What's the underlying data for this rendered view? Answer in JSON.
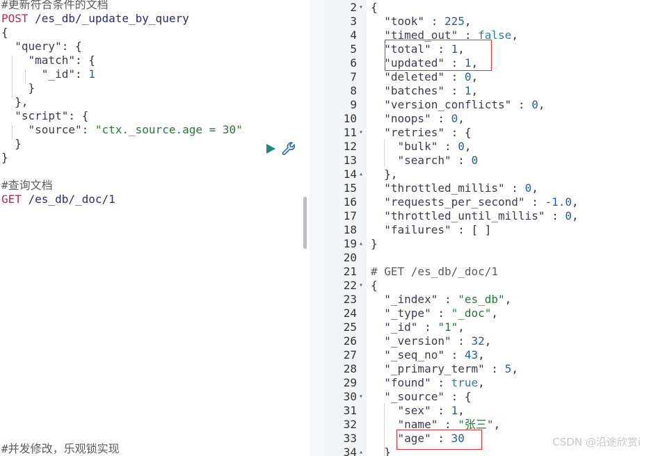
{
  "request_editor": {
    "lines": [
      {
        "parts": [
          [
            "comment",
            "#更新符合条件的文档"
          ]
        ]
      },
      {
        "parts": [
          [
            "method",
            "POST"
          ],
          [
            "url",
            " /es_db/_update_by_query"
          ]
        ]
      },
      {
        "parts": [
          [
            "punc",
            "{"
          ]
        ]
      },
      {
        "parts": [
          [
            "punc",
            "  "
          ],
          [
            "key",
            "\"query\""
          ],
          [
            "punc",
            ": {"
          ]
        ]
      },
      {
        "parts": [
          [
            "punc",
            "    "
          ],
          [
            "key",
            "\"match\""
          ],
          [
            "punc",
            ": {"
          ]
        ]
      },
      {
        "parts": [
          [
            "punc",
            "      "
          ],
          [
            "key",
            "\"_id\""
          ],
          [
            "punc",
            ": "
          ],
          [
            "num",
            "1"
          ]
        ]
      },
      {
        "parts": [
          [
            "punc",
            "    }"
          ]
        ]
      },
      {
        "parts": [
          [
            "punc",
            "  },"
          ]
        ]
      },
      {
        "parts": [
          [
            "punc",
            "  "
          ],
          [
            "key",
            "\"script\""
          ],
          [
            "punc",
            ": {"
          ]
        ]
      },
      {
        "parts": [
          [
            "punc",
            "    "
          ],
          [
            "key",
            "\"source\""
          ],
          [
            "punc",
            ": "
          ],
          [
            "str",
            "\"ctx._source.age = 30\""
          ]
        ]
      },
      {
        "parts": [
          [
            "punc",
            "  }"
          ]
        ]
      },
      {
        "parts": [
          [
            "punc",
            "}"
          ]
        ]
      },
      {
        "parts": []
      },
      {
        "parts": [
          [
            "comment",
            "#查询文档"
          ]
        ]
      },
      {
        "parts": [
          [
            "method",
            "GET"
          ],
          [
            "url",
            " /es_db/_doc/1"
          ]
        ]
      }
    ],
    "bottom_comment": "#并发修改，乐观锁实现",
    "play_icon": "play-icon",
    "wrench_icon": "wrench-icon"
  },
  "response_viewer": {
    "lines": [
      {
        "n": "2",
        "fold": "▾",
        "parts": [
          [
            "punc",
            "{"
          ]
        ]
      },
      {
        "n": "3",
        "fold": "",
        "parts": [
          [
            "punc",
            "  "
          ],
          [
            "key",
            "\"took\""
          ],
          [
            "punc",
            " : "
          ],
          [
            "num",
            "225"
          ],
          [
            "punc",
            ","
          ]
        ]
      },
      {
        "n": "4",
        "fold": "",
        "parts": [
          [
            "punc",
            "  "
          ],
          [
            "key",
            "\"timed_out\""
          ],
          [
            "punc",
            " : "
          ],
          [
            "kw",
            "false"
          ],
          [
            "punc",
            ","
          ]
        ]
      },
      {
        "n": "5",
        "fold": "",
        "parts": [
          [
            "punc",
            "  "
          ],
          [
            "key",
            "\"total\""
          ],
          [
            "punc",
            " : "
          ],
          [
            "num",
            "1"
          ],
          [
            "punc",
            ","
          ]
        ]
      },
      {
        "n": "6",
        "fold": "",
        "parts": [
          [
            "punc",
            "  "
          ],
          [
            "key",
            "\"updated\""
          ],
          [
            "punc",
            " : "
          ],
          [
            "num",
            "1"
          ],
          [
            "punc",
            ","
          ]
        ]
      },
      {
        "n": "7",
        "fold": "",
        "parts": [
          [
            "punc",
            "  "
          ],
          [
            "key",
            "\"deleted\""
          ],
          [
            "punc",
            " : "
          ],
          [
            "num",
            "0"
          ],
          [
            "punc",
            ","
          ]
        ]
      },
      {
        "n": "8",
        "fold": "",
        "parts": [
          [
            "punc",
            "  "
          ],
          [
            "key",
            "\"batches\""
          ],
          [
            "punc",
            " : "
          ],
          [
            "num",
            "1"
          ],
          [
            "punc",
            ","
          ]
        ]
      },
      {
        "n": "9",
        "fold": "",
        "parts": [
          [
            "punc",
            "  "
          ],
          [
            "key",
            "\"version_conflicts\""
          ],
          [
            "punc",
            " : "
          ],
          [
            "num",
            "0"
          ],
          [
            "punc",
            ","
          ]
        ]
      },
      {
        "n": "10",
        "fold": "",
        "parts": [
          [
            "punc",
            "  "
          ],
          [
            "key",
            "\"noops\""
          ],
          [
            "punc",
            " : "
          ],
          [
            "num",
            "0"
          ],
          [
            "punc",
            ","
          ]
        ]
      },
      {
        "n": "11",
        "fold": "▾",
        "parts": [
          [
            "punc",
            "  "
          ],
          [
            "key",
            "\"retries\""
          ],
          [
            "punc",
            " : {"
          ]
        ]
      },
      {
        "n": "12",
        "fold": "",
        "parts": [
          [
            "punc",
            "    "
          ],
          [
            "key",
            "\"bulk\""
          ],
          [
            "punc",
            " : "
          ],
          [
            "num",
            "0"
          ],
          [
            "punc",
            ","
          ]
        ]
      },
      {
        "n": "13",
        "fold": "",
        "parts": [
          [
            "punc",
            "    "
          ],
          [
            "key",
            "\"search\""
          ],
          [
            "punc",
            " : "
          ],
          [
            "num",
            "0"
          ]
        ]
      },
      {
        "n": "14",
        "fold": "▴",
        "parts": [
          [
            "punc",
            "  },"
          ]
        ]
      },
      {
        "n": "15",
        "fold": "",
        "parts": [
          [
            "punc",
            "  "
          ],
          [
            "key",
            "\"throttled_millis\""
          ],
          [
            "punc",
            " : "
          ],
          [
            "num",
            "0"
          ],
          [
            "punc",
            ","
          ]
        ]
      },
      {
        "n": "16",
        "fold": "",
        "parts": [
          [
            "punc",
            "  "
          ],
          [
            "key",
            "\"requests_per_second\""
          ],
          [
            "punc",
            " : "
          ],
          [
            "num",
            "-1.0"
          ],
          [
            "punc",
            ","
          ]
        ]
      },
      {
        "n": "17",
        "fold": "",
        "parts": [
          [
            "punc",
            "  "
          ],
          [
            "key",
            "\"throttled_until_millis\""
          ],
          [
            "punc",
            " : "
          ],
          [
            "num",
            "0"
          ],
          [
            "punc",
            ","
          ]
        ]
      },
      {
        "n": "18",
        "fold": "",
        "parts": [
          [
            "punc",
            "  "
          ],
          [
            "key",
            "\"failures\""
          ],
          [
            "punc",
            " : [ ]"
          ]
        ]
      },
      {
        "n": "19",
        "fold": "▴",
        "parts": [
          [
            "punc",
            "}"
          ]
        ]
      },
      {
        "n": "20",
        "fold": "",
        "parts": []
      },
      {
        "n": "21",
        "fold": "",
        "parts": [
          [
            "comment",
            "# GET /es_db/_doc/1"
          ]
        ]
      },
      {
        "n": "22",
        "fold": "▾",
        "parts": [
          [
            "punc",
            "{"
          ]
        ]
      },
      {
        "n": "23",
        "fold": "",
        "parts": [
          [
            "punc",
            "  "
          ],
          [
            "key",
            "\"_index\""
          ],
          [
            "punc",
            " : "
          ],
          [
            "str",
            "\"es_db\""
          ],
          [
            "punc",
            ","
          ]
        ]
      },
      {
        "n": "24",
        "fold": "",
        "parts": [
          [
            "punc",
            "  "
          ],
          [
            "key",
            "\"_type\""
          ],
          [
            "punc",
            " : "
          ],
          [
            "str",
            "\"_doc\""
          ],
          [
            "punc",
            ","
          ]
        ]
      },
      {
        "n": "25",
        "fold": "",
        "parts": [
          [
            "punc",
            "  "
          ],
          [
            "key",
            "\"_id\""
          ],
          [
            "punc",
            " : "
          ],
          [
            "str",
            "\"1\""
          ],
          [
            "punc",
            ","
          ]
        ]
      },
      {
        "n": "26",
        "fold": "",
        "parts": [
          [
            "punc",
            "  "
          ],
          [
            "key",
            "\"_version\""
          ],
          [
            "punc",
            " : "
          ],
          [
            "num",
            "32"
          ],
          [
            "punc",
            ","
          ]
        ]
      },
      {
        "n": "27",
        "fold": "",
        "parts": [
          [
            "punc",
            "  "
          ],
          [
            "key",
            "\"_seq_no\""
          ],
          [
            "punc",
            " : "
          ],
          [
            "num",
            "43"
          ],
          [
            "punc",
            ","
          ]
        ]
      },
      {
        "n": "28",
        "fold": "",
        "parts": [
          [
            "punc",
            "  "
          ],
          [
            "key",
            "\"_primary_term\""
          ],
          [
            "punc",
            " : "
          ],
          [
            "num",
            "5"
          ],
          [
            "punc",
            ","
          ]
        ]
      },
      {
        "n": "29",
        "fold": "",
        "parts": [
          [
            "punc",
            "  "
          ],
          [
            "key",
            "\"found\""
          ],
          [
            "punc",
            " : "
          ],
          [
            "kw",
            "true"
          ],
          [
            "punc",
            ","
          ]
        ]
      },
      {
        "n": "30",
        "fold": "▾",
        "parts": [
          [
            "punc",
            "  "
          ],
          [
            "key",
            "\"_source\""
          ],
          [
            "punc",
            " : {"
          ]
        ]
      },
      {
        "n": "31",
        "fold": "",
        "parts": [
          [
            "punc",
            "    "
          ],
          [
            "key",
            "\"sex\""
          ],
          [
            "punc",
            " : "
          ],
          [
            "num",
            "1"
          ],
          [
            "punc",
            ","
          ]
        ]
      },
      {
        "n": "32",
        "fold": "",
        "parts": [
          [
            "punc",
            "    "
          ],
          [
            "key",
            "\"name\""
          ],
          [
            "punc",
            " : "
          ],
          [
            "str",
            "\"张三\""
          ],
          [
            "punc",
            ","
          ]
        ]
      },
      {
        "n": "33",
        "fold": "",
        "parts": [
          [
            "punc",
            "    "
          ],
          [
            "key",
            "\"age\""
          ],
          [
            "punc",
            " : "
          ],
          [
            "num",
            "30"
          ]
        ]
      },
      {
        "n": "34",
        "fold": "▴",
        "parts": [
          [
            "punc",
            "  }"
          ]
        ]
      }
    ]
  },
  "divider": {
    "grip_icon": "‖"
  },
  "watermark": "CSDN @沿途欣赏i",
  "colors": {
    "highlight_box": "#e0302f"
  }
}
